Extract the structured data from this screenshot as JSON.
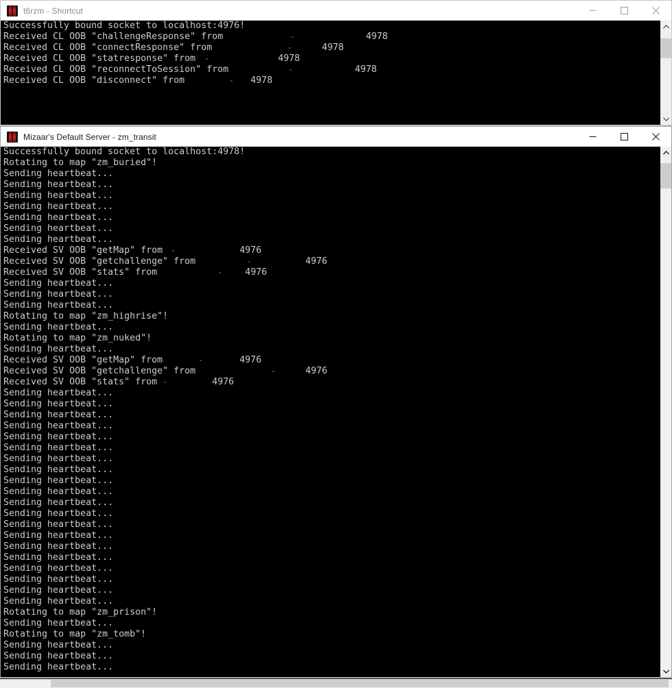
{
  "colors": {
    "console_background": "#000000",
    "console_text": "#cccccc",
    "titlebar_background": "#ffffff",
    "inactive_title_text": "#8a8a8a",
    "active_title_text": "#1a1a1a",
    "scrollbar_track": "#f0f0f0",
    "scrollbar_thumb": "#cdcdcd",
    "icon_accent": "#d42222"
  },
  "windows": [
    {
      "id": "client-console",
      "title": "t6rzm - Shortcut",
      "active": false,
      "icon": "app-icon",
      "buttons": {
        "minimize": "Minimize",
        "maximize": "Maximize",
        "close": "Close"
      },
      "scrollbar": {
        "up_arrow": "scroll-up-arrow",
        "down_arrow": "scroll-down-arrow",
        "thumb_top_pct": 8,
        "thumb_height_pct": 24
      },
      "lines": [
        "Successfully bound socket to localhost:4976!",
        "Received CL OOB \"challengeResponse\" from",
        "Received CL OOB \"connectResponse\" from",
        "Received CL OOB \"statresponse\" from",
        "Received CL OOB \"reconnectToSession\" from",
        "Received CL OOB \"disconnect\" from"
      ],
      "line_ports": [
        "",
        "4978",
        "4978",
        "4978",
        "4978",
        "4978"
      ],
      "redaction_widths": [
        0,
        26,
        20,
        15,
        23,
        12
      ],
      "port_indents": [
        0,
        28,
        26,
        22,
        29,
        17
      ]
    },
    {
      "id": "server-console",
      "title": "Mizaar's Default Server - zm_transit",
      "active": true,
      "icon": "app-icon",
      "buttons": {
        "minimize": "Minimize",
        "maximize": "Maximize",
        "close": "Close"
      },
      "scrollbar": {
        "up_arrow": "scroll-up-arrow",
        "down_arrow": "scroll-down-arrow",
        "thumb_top_pct": 1,
        "thumb_height_pct": 5
      },
      "lines": [
        "Successfully bound socket to localhost:4978!",
        "Rotating to map \"zm_buried\"!",
        "Sending heartbeat...",
        "Sending heartbeat...",
        "Sending heartbeat...",
        "Sending heartbeat...",
        "Sending heartbeat...",
        "Sending heartbeat...",
        "Sending heartbeat...",
        "Received SV OOB \"getMap\" from",
        "Received SV OOB \"getchallenge\" from",
        "Received SV OOB \"stats\" from",
        "Sending heartbeat...",
        "Sending heartbeat...",
        "Sending heartbeat...",
        "Rotating to map \"zm_highrise\"!",
        "Sending heartbeat...",
        "Rotating to map \"zm_nuked\"!",
        "Sending heartbeat...",
        "Received SV OOB \"getMap\" from",
        "Received SV OOB \"getchallenge\" from",
        "Received SV OOB \"stats\" from",
        "Sending heartbeat...",
        "Sending heartbeat...",
        "Sending heartbeat...",
        "Sending heartbeat...",
        "Sending heartbeat...",
        "Sending heartbeat...",
        "Sending heartbeat...",
        "Sending heartbeat...",
        "Sending heartbeat...",
        "Sending heartbeat...",
        "Sending heartbeat...",
        "Sending heartbeat...",
        "Sending heartbeat...",
        "Sending heartbeat...",
        "Sending heartbeat...",
        "Sending heartbeat...",
        "Sending heartbeat...",
        "Sending heartbeat...",
        "Sending heartbeat...",
        "Sending heartbeat...",
        "Rotating to map \"zm_prison\"!",
        "Sending heartbeat...",
        "Rotating to map \"zm_tomb\"!",
        "Sending heartbeat...",
        "Sending heartbeat...",
        "Sending heartbeat..."
      ],
      "oob_lines": [
        {
          "index": 9,
          "port": "4976",
          "redact_width": 14,
          "port_indent": 18
        },
        {
          "index": 10,
          "port": "4976",
          "redact_width": 20,
          "port_indent": 24
        },
        {
          "index": 11,
          "port": "4976",
          "redact_width": 16,
          "port_indent": 18
        },
        {
          "index": 19,
          "port": "4976",
          "redact_width": 14,
          "port_indent": 16
        },
        {
          "index": 20,
          "port": "4976",
          "redact_width": 20,
          "port_indent": 23
        },
        {
          "index": 21,
          "port": "4976",
          "redact_width": 10,
          "port_indent": 13
        }
      ]
    }
  ],
  "bottom_scrollbar": {
    "name": "horizontal-scrollbar",
    "thumb_left_pct": 7.5,
    "thumb_width_pct": 92
  }
}
